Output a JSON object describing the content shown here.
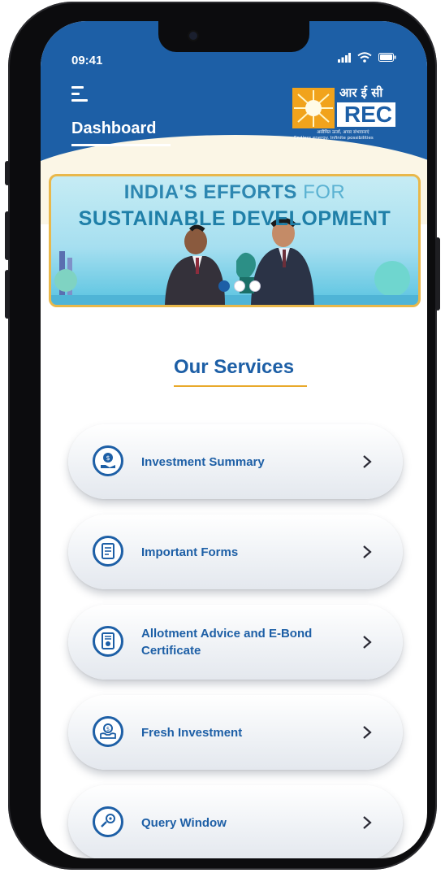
{
  "status_bar": {
    "time": "09:41"
  },
  "header": {
    "title": "Dashboard"
  },
  "logo": {
    "hindi": "आर ई सी",
    "name": "REC",
    "tagline_hindi": "असीमित ऊर्जा, अपार संभावनाएं",
    "tagline_en": "Endless energy. Infinite possibilities"
  },
  "banner": {
    "line1_a": "INDIA'S EFFORTS",
    "line1_b": " FOR",
    "line2": "SUSTAINABLE DEVELOPMENT",
    "slides_total": 3,
    "active_slide": 1
  },
  "services": {
    "title": "Our Services",
    "items": [
      {
        "label": "Investment Summary",
        "icon": "money-bag-hand-icon"
      },
      {
        "label": "Important Forms",
        "icon": "form-document-icon"
      },
      {
        "label": "Allotment Advice and E-Bond Certificate",
        "icon": "certificate-icon"
      },
      {
        "label": "Fresh Investment",
        "icon": "investment-hands-icon"
      },
      {
        "label": "Query Window",
        "icon": "query-chat-icon"
      }
    ]
  },
  "colors": {
    "brand_blue": "#1d5fa6",
    "accent_gold": "#e9a92b",
    "background_cream": "#fbf6e6"
  }
}
